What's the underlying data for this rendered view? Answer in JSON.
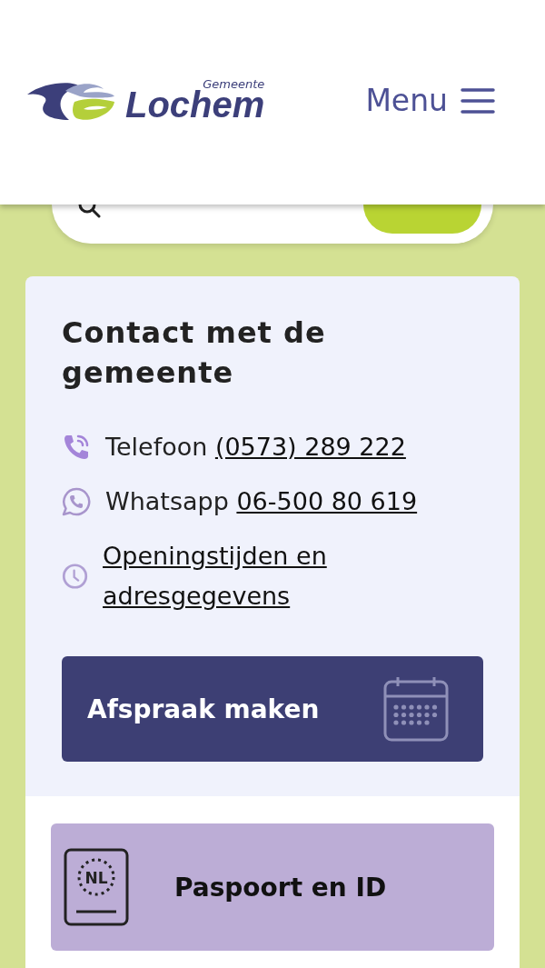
{
  "header": {
    "logo": {
      "small": "Gemeente",
      "name": "Lochem"
    },
    "menu": {
      "label": "Menu"
    }
  },
  "contact": {
    "title": "Contact met de gemeente",
    "items": [
      {
        "kind": "phone",
        "label": "Telefoon",
        "link": "(0573) 289 222"
      },
      {
        "kind": "whatsapp",
        "label": "Whatsapp",
        "link": "06-500 80 619"
      },
      {
        "kind": "clock",
        "link": "Openingstijden en adresgegevens"
      }
    ],
    "button": {
      "label": "Afspraak maken"
    }
  },
  "tiles": [
    {
      "kind": "passport",
      "icon_text": "NL",
      "label": "Paspoort en ID"
    }
  ]
}
